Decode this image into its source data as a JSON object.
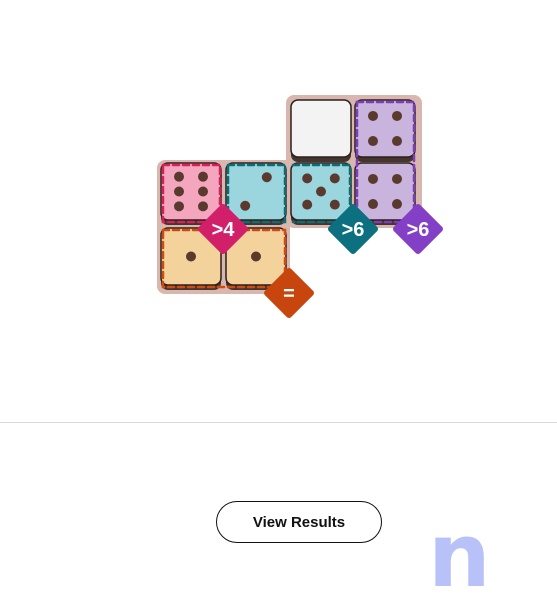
{
  "colors": {
    "frame": "#d8b7ae",
    "pink_fill": "#f4a6bf",
    "pink_border": "#d81e5b",
    "pink_badge": "#d21f6a",
    "teal_fill": "#9bd5de",
    "teal_border": "#0d6d76",
    "teal_badge": "#0d7080",
    "purple_fill": "#c9b4de",
    "purple_border": "#7a3fb9",
    "purple_badge": "#8340c6",
    "orange_fill": "#f4d29c",
    "orange_border": "#cf4b12",
    "orange_badge": "#c8450e",
    "empty_fill": "#f3f3f3",
    "pip": "#5a3a2e",
    "outline": "#2c1f1a",
    "logo": "#b9c2f8"
  },
  "board": {
    "cells": [
      {
        "name": "die-empty-top",
        "pips": 0,
        "color": "empty"
      },
      {
        "name": "die-purple-top",
        "pips": 4,
        "color": "purple"
      },
      {
        "name": "die-pink",
        "pips": 6,
        "color": "pink"
      },
      {
        "name": "die-teal-left",
        "pips": 2,
        "color": "teal"
      },
      {
        "name": "die-teal-right",
        "pips": 5,
        "color": "teal"
      },
      {
        "name": "die-purple-bottom",
        "pips": 4,
        "color": "purple"
      },
      {
        "name": "die-orange-left",
        "pips": 1,
        "color": "orange"
      },
      {
        "name": "die-orange-right",
        "pips": 1,
        "color": "orange"
      }
    ],
    "constraints": [
      {
        "name": "constraint-badge-pink",
        "label": ">4",
        "color": "pink"
      },
      {
        "name": "constraint-badge-teal",
        "label": ">6",
        "color": "teal"
      },
      {
        "name": "constraint-badge-purple",
        "label": ">6",
        "color": "purple"
      },
      {
        "name": "constraint-badge-orange",
        "label": "=",
        "color": "orange"
      }
    ]
  },
  "actions": {
    "view_results_label": "View Results"
  },
  "logo": {
    "icon": "n-logo-icon",
    "text": "n"
  }
}
